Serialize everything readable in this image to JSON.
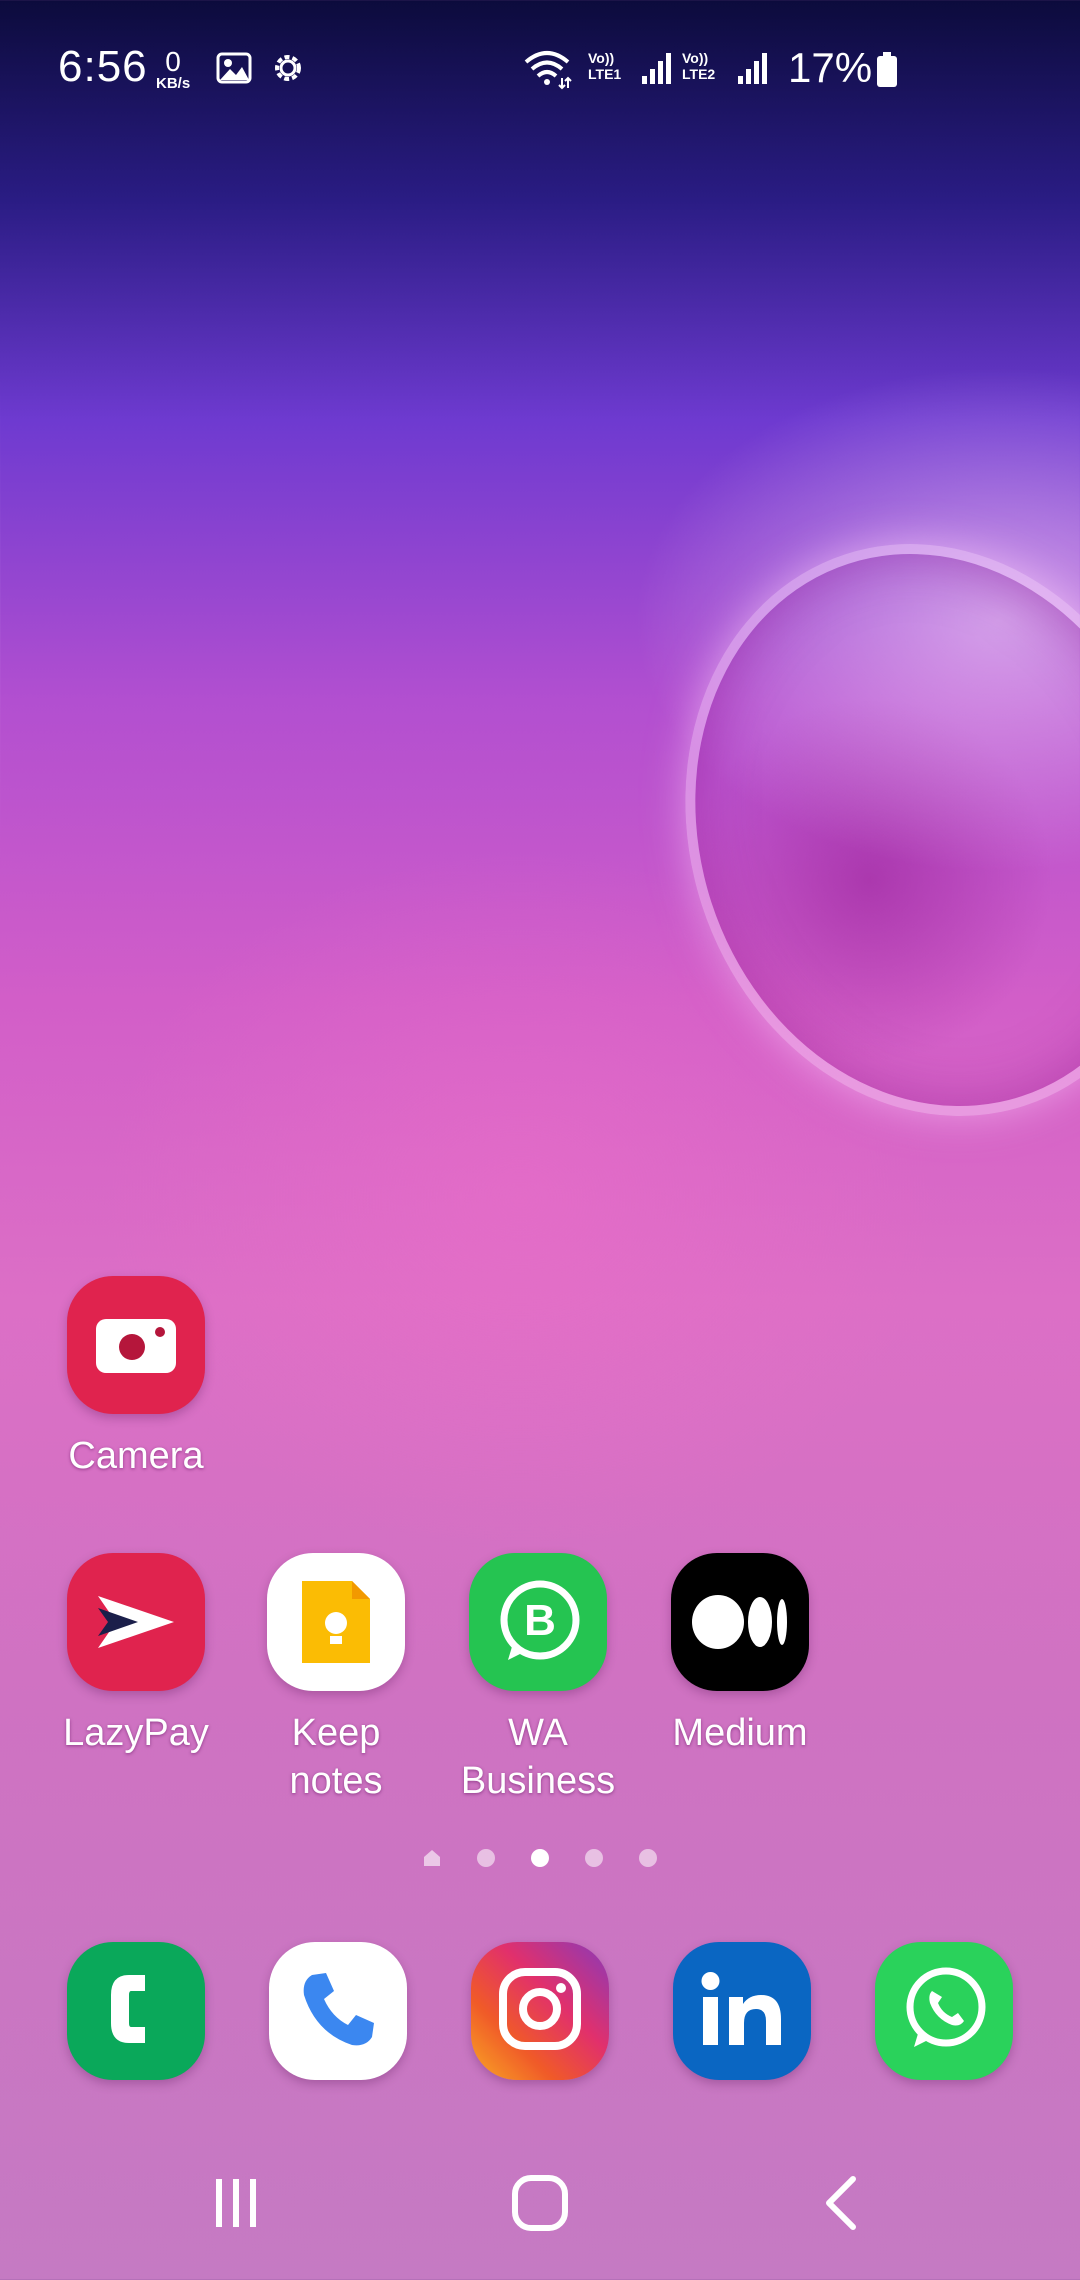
{
  "status_bar": {
    "time": "6:56",
    "net_speed_value": "0",
    "net_speed_unit": "KB/s",
    "icons": [
      "gallery-notification-icon",
      "settings-notification-icon",
      "wifi-icon",
      "signal-sim1-icon",
      "signal-sim2-icon",
      "battery-icon"
    ],
    "sim1_label_top": "Vo))",
    "sim1_label_bottom": "LTE1",
    "sim2_label_top": "Vo))",
    "sim2_label_bottom": "LTE2",
    "battery_percent": "17%"
  },
  "home": {
    "apps": [
      {
        "label": "Camera",
        "icon": "camera-icon",
        "color": "#e0234e"
      },
      {
        "label": "LazyPay",
        "icon": "lazypay-icon",
        "color": "#e0234e"
      },
      {
        "label": "Keep\nnotes",
        "icon": "keep-notes-icon",
        "color": "#ffffff"
      },
      {
        "label": "WA\nBusiness",
        "icon": "wa-business-icon",
        "color": "#25c451"
      },
      {
        "label": "Medium",
        "icon": "medium-icon",
        "color": "#000000"
      }
    ],
    "page_indicator": {
      "pages": 5,
      "current": 3,
      "first_is_home": true
    }
  },
  "dock": {
    "apps": [
      {
        "icon": "phone-green-icon",
        "color": "#0aa85a"
      },
      {
        "icon": "phone-icon",
        "color": "#ffffff"
      },
      {
        "icon": "instagram-icon",
        "color": "#e1306c"
      },
      {
        "icon": "linkedin-icon",
        "color": "#0a66c2"
      },
      {
        "icon": "whatsapp-icon",
        "color": "#2ad25b"
      }
    ]
  },
  "nav_bar": {
    "buttons": [
      "recents-icon",
      "home-icon",
      "back-icon"
    ]
  }
}
